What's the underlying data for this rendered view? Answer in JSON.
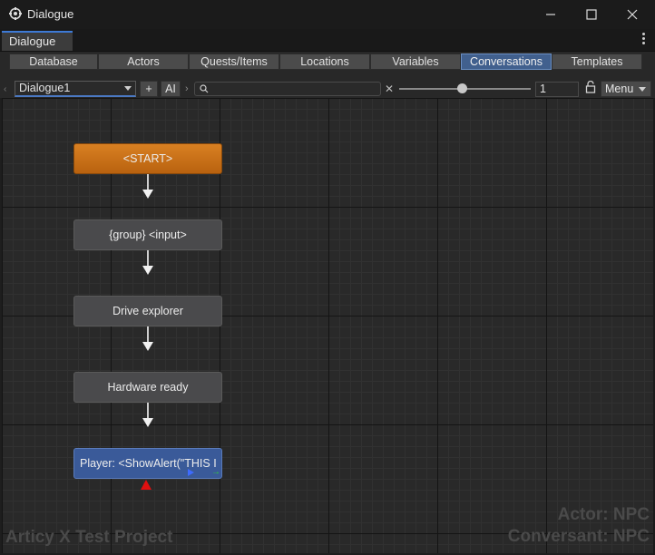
{
  "window": {
    "title": "Dialogue",
    "icon": "unity-gear-icon"
  },
  "tab": {
    "label": "Dialogue"
  },
  "section_tabs": [
    {
      "label": "Database"
    },
    {
      "label": "Actors"
    },
    {
      "label": "Quests/Items"
    },
    {
      "label": "Locations"
    },
    {
      "label": "Variables"
    },
    {
      "label": "Conversations",
      "active": true
    },
    {
      "label": "Templates"
    }
  ],
  "toolbar": {
    "conversation_select": "Dialogue1",
    "add_label": "+",
    "ai_label": "AI",
    "search_value": "",
    "zoom_value": "1",
    "menu_label": "Menu"
  },
  "nodes": [
    {
      "label": "<START>",
      "kind": "start"
    },
    {
      "label": "{group} <input>",
      "kind": "normal"
    },
    {
      "label": "Drive explorer",
      "kind": "normal"
    },
    {
      "label": "Hardware ready",
      "kind": "normal"
    },
    {
      "label": "Player: <ShowAlert(\"THIS I",
      "kind": "player"
    }
  ],
  "watermarks": {
    "project": "Articy X Test Project",
    "actor": "Actor: NPC",
    "conversant": "Conversant: NPC"
  },
  "colors": {
    "start_node": "#d17a1e",
    "player_node": "#3a5a99",
    "active_tab": "#41608e",
    "canvas": "#292929"
  }
}
